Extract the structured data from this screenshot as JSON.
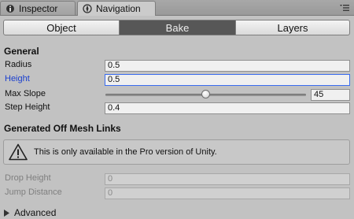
{
  "tabs": [
    {
      "label": "Inspector",
      "icon": "inspector-icon"
    },
    {
      "label": "Navigation",
      "icon": "navigation-icon"
    }
  ],
  "toolbar": {
    "object_label": "Object",
    "bake_label": "Bake",
    "layers_label": "Layers",
    "selected": "Bake"
  },
  "general": {
    "title": "General",
    "radius_label": "Radius",
    "radius_value": "0.5",
    "height_label": "Height",
    "height_value": "0.5",
    "max_slope_label": "Max Slope",
    "max_slope_value": "45",
    "max_slope_fraction": 0.5,
    "step_height_label": "Step Height",
    "step_height_value": "0.4"
  },
  "links": {
    "title": "Generated Off Mesh Links",
    "help_text": "This is only available in the Pro version of Unity.",
    "drop_height_label": "Drop Height",
    "drop_height_value": "0",
    "jump_distance_label": "Jump Distance",
    "jump_distance_value": "0"
  },
  "advanced": {
    "label": "Advanced",
    "expanded": false
  },
  "colors": {
    "panel_bg": "#c2c2c2",
    "selected_tab": "#575757",
    "focus_blue": "#3a6cf0",
    "focus_label": "#1a3fcf"
  }
}
